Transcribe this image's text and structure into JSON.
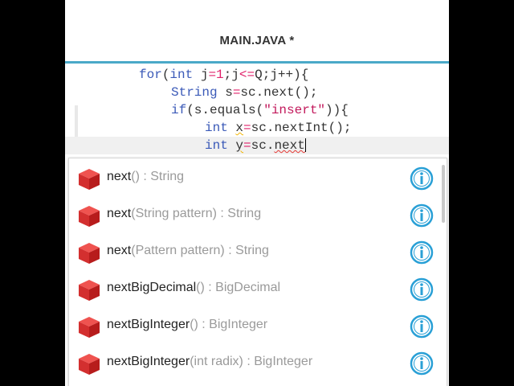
{
  "header": {
    "title": "MAIN.JAVA *"
  },
  "code": {
    "line1": {
      "kw": "for",
      "open": "(",
      "type": "int",
      "var": " j",
      "eq": "=",
      "num": "1",
      "semi1": ";",
      "cond_a": "j",
      "le": "<=",
      "cond_b": "Q",
      "semi2": ";",
      "inc": "j++",
      "close": "){"
    },
    "line2": {
      "type": "String",
      "rest_a": " s",
      "eq": "=",
      "rest_b": "sc.next();"
    },
    "line3": {
      "kw": "if",
      "open": "(s.equals(",
      "str": "\"insert\"",
      "close": ")){"
    },
    "line4": {
      "type": "int",
      "var": "x",
      "eq": "=",
      "rest": "sc.nextInt();"
    },
    "line5": {
      "type": "int",
      "var": "y",
      "eq": "=",
      "rest": "sc.",
      "typed": "next"
    }
  },
  "completions": [
    {
      "name": "next",
      "signature": "() : String"
    },
    {
      "name": "next",
      "signature": "(String pattern) : String"
    },
    {
      "name": "next",
      "signature": "(Pattern pattern) : String"
    },
    {
      "name": "nextBigDecimal",
      "signature": "() : BigDecimal"
    },
    {
      "name": "nextBigInteger",
      "signature": "() : BigInteger"
    },
    {
      "name": "nextBigInteger",
      "signature": "(int radix) : BigInteger"
    }
  ],
  "colors": {
    "accent": "#4aa9c8",
    "cube": "#d32f2f",
    "keyword": "#3b5ab8",
    "literal": "#e0226b"
  },
  "icons": {
    "method": "red-cube-icon",
    "info": "info-icon"
  }
}
